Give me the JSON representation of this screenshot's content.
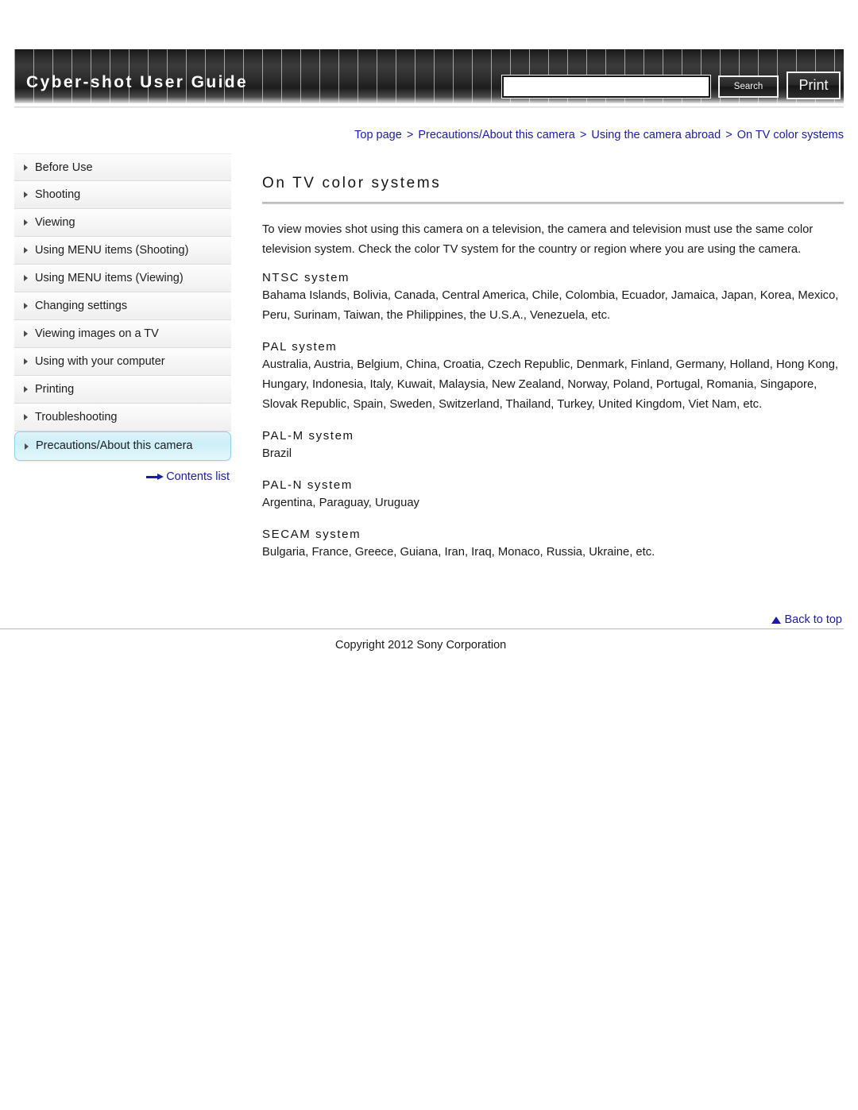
{
  "header": {
    "brand_title": "Cyber-shot User Guide",
    "search": {
      "value": "",
      "placeholder": ""
    },
    "search_button_label": "Search",
    "print_button_label": "Print"
  },
  "breadcrumb": {
    "separator": ">",
    "items": [
      "Top page",
      "Precautions/About this camera",
      "Using the camera abroad",
      "On TV color systems"
    ]
  },
  "sidebar": {
    "items": [
      {
        "label": "Before Use",
        "active": false
      },
      {
        "label": "Shooting",
        "active": false
      },
      {
        "label": "Viewing",
        "active": false
      },
      {
        "label": "Using MENU items (Shooting)",
        "active": false
      },
      {
        "label": "Using MENU items (Viewing)",
        "active": false
      },
      {
        "label": "Changing settings",
        "active": false
      },
      {
        "label": "Viewing images on a TV",
        "active": false
      },
      {
        "label": "Using with your computer",
        "active": false
      },
      {
        "label": "Printing",
        "active": false
      },
      {
        "label": "Troubleshooting",
        "active": false
      },
      {
        "label": "Precautions/About this camera",
        "active": true
      }
    ],
    "contents_list_label": "Contents list"
  },
  "main": {
    "title": "On TV color systems",
    "intro": "To view movies shot using this camera on a television, the camera and television must use the same color television system. Check the color TV system for the country or region where you are using the camera.",
    "systems": [
      {
        "heading": "NTSC system",
        "countries": "Bahama Islands, Bolivia, Canada, Central America, Chile, Colombia, Ecuador, Jamaica, Japan, Korea, Mexico, Peru, Surinam, Taiwan, the Philippines, the U.S.A., Venezuela, etc."
      },
      {
        "heading": "PAL system",
        "countries": "Australia, Austria, Belgium, China, Croatia, Czech Republic, Denmark, Finland, Germany, Holland, Hong Kong, Hungary, Indonesia, Italy, Kuwait, Malaysia, New Zealand, Norway, Poland, Portugal, Romania, Singapore, Slovak Republic, Spain, Sweden, Switzerland, Thailand, Turkey, United Kingdom, Viet Nam, etc."
      },
      {
        "heading": "PAL-M system",
        "countries": "Brazil"
      },
      {
        "heading": "PAL-N system",
        "countries": "Argentina, Paraguay, Uruguay"
      },
      {
        "heading": "SECAM system",
        "countries": "Bulgaria, France, Greece, Guiana, Iran, Iraq, Monaco, Russia, Ukraine, etc."
      }
    ]
  },
  "footer": {
    "back_to_top_label": "Back to top",
    "copyright": "Copyright 2012 Sony Corporation"
  },
  "colors": {
    "link_blue": "#1b1ba8",
    "active_nav_bg": "#cdeef8",
    "active_nav_border": "#8cd4e8",
    "header_dark": "#2b2b2b",
    "rule_gray": "#b6b6b6"
  }
}
